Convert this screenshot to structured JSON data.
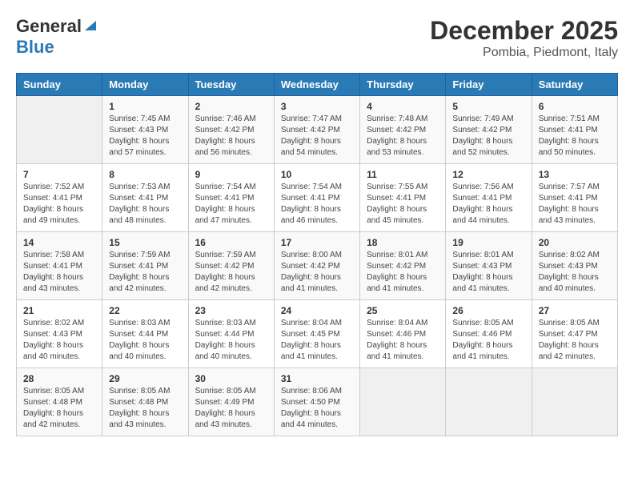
{
  "logo": {
    "general": "General",
    "blue": "Blue"
  },
  "title": "December 2025",
  "subtitle": "Pombia, Piedmont, Italy",
  "days_of_week": [
    "Sunday",
    "Monday",
    "Tuesday",
    "Wednesday",
    "Thursday",
    "Friday",
    "Saturday"
  ],
  "weeks": [
    [
      {
        "day": "",
        "info": ""
      },
      {
        "day": "1",
        "info": "Sunrise: 7:45 AM\nSunset: 4:43 PM\nDaylight: 8 hours\nand 57 minutes."
      },
      {
        "day": "2",
        "info": "Sunrise: 7:46 AM\nSunset: 4:42 PM\nDaylight: 8 hours\nand 56 minutes."
      },
      {
        "day": "3",
        "info": "Sunrise: 7:47 AM\nSunset: 4:42 PM\nDaylight: 8 hours\nand 54 minutes."
      },
      {
        "day": "4",
        "info": "Sunrise: 7:48 AM\nSunset: 4:42 PM\nDaylight: 8 hours\nand 53 minutes."
      },
      {
        "day": "5",
        "info": "Sunrise: 7:49 AM\nSunset: 4:42 PM\nDaylight: 8 hours\nand 52 minutes."
      },
      {
        "day": "6",
        "info": "Sunrise: 7:51 AM\nSunset: 4:41 PM\nDaylight: 8 hours\nand 50 minutes."
      }
    ],
    [
      {
        "day": "7",
        "info": "Sunrise: 7:52 AM\nSunset: 4:41 PM\nDaylight: 8 hours\nand 49 minutes."
      },
      {
        "day": "8",
        "info": "Sunrise: 7:53 AM\nSunset: 4:41 PM\nDaylight: 8 hours\nand 48 minutes."
      },
      {
        "day": "9",
        "info": "Sunrise: 7:54 AM\nSunset: 4:41 PM\nDaylight: 8 hours\nand 47 minutes."
      },
      {
        "day": "10",
        "info": "Sunrise: 7:54 AM\nSunset: 4:41 PM\nDaylight: 8 hours\nand 46 minutes."
      },
      {
        "day": "11",
        "info": "Sunrise: 7:55 AM\nSunset: 4:41 PM\nDaylight: 8 hours\nand 45 minutes."
      },
      {
        "day": "12",
        "info": "Sunrise: 7:56 AM\nSunset: 4:41 PM\nDaylight: 8 hours\nand 44 minutes."
      },
      {
        "day": "13",
        "info": "Sunrise: 7:57 AM\nSunset: 4:41 PM\nDaylight: 8 hours\nand 43 minutes."
      }
    ],
    [
      {
        "day": "14",
        "info": "Sunrise: 7:58 AM\nSunset: 4:41 PM\nDaylight: 8 hours\nand 43 minutes."
      },
      {
        "day": "15",
        "info": "Sunrise: 7:59 AM\nSunset: 4:41 PM\nDaylight: 8 hours\nand 42 minutes."
      },
      {
        "day": "16",
        "info": "Sunrise: 7:59 AM\nSunset: 4:42 PM\nDaylight: 8 hours\nand 42 minutes."
      },
      {
        "day": "17",
        "info": "Sunrise: 8:00 AM\nSunset: 4:42 PM\nDaylight: 8 hours\nand 41 minutes."
      },
      {
        "day": "18",
        "info": "Sunrise: 8:01 AM\nSunset: 4:42 PM\nDaylight: 8 hours\nand 41 minutes."
      },
      {
        "day": "19",
        "info": "Sunrise: 8:01 AM\nSunset: 4:43 PM\nDaylight: 8 hours\nand 41 minutes."
      },
      {
        "day": "20",
        "info": "Sunrise: 8:02 AM\nSunset: 4:43 PM\nDaylight: 8 hours\nand 40 minutes."
      }
    ],
    [
      {
        "day": "21",
        "info": "Sunrise: 8:02 AM\nSunset: 4:43 PM\nDaylight: 8 hours\nand 40 minutes."
      },
      {
        "day": "22",
        "info": "Sunrise: 8:03 AM\nSunset: 4:44 PM\nDaylight: 8 hours\nand 40 minutes."
      },
      {
        "day": "23",
        "info": "Sunrise: 8:03 AM\nSunset: 4:44 PM\nDaylight: 8 hours\nand 40 minutes."
      },
      {
        "day": "24",
        "info": "Sunrise: 8:04 AM\nSunset: 4:45 PM\nDaylight: 8 hours\nand 41 minutes."
      },
      {
        "day": "25",
        "info": "Sunrise: 8:04 AM\nSunset: 4:46 PM\nDaylight: 8 hours\nand 41 minutes."
      },
      {
        "day": "26",
        "info": "Sunrise: 8:05 AM\nSunset: 4:46 PM\nDaylight: 8 hours\nand 41 minutes."
      },
      {
        "day": "27",
        "info": "Sunrise: 8:05 AM\nSunset: 4:47 PM\nDaylight: 8 hours\nand 42 minutes."
      }
    ],
    [
      {
        "day": "28",
        "info": "Sunrise: 8:05 AM\nSunset: 4:48 PM\nDaylight: 8 hours\nand 42 minutes."
      },
      {
        "day": "29",
        "info": "Sunrise: 8:05 AM\nSunset: 4:48 PM\nDaylight: 8 hours\nand 43 minutes."
      },
      {
        "day": "30",
        "info": "Sunrise: 8:05 AM\nSunset: 4:49 PM\nDaylight: 8 hours\nand 43 minutes."
      },
      {
        "day": "31",
        "info": "Sunrise: 8:06 AM\nSunset: 4:50 PM\nDaylight: 8 hours\nand 44 minutes."
      },
      {
        "day": "",
        "info": ""
      },
      {
        "day": "",
        "info": ""
      },
      {
        "day": "",
        "info": ""
      }
    ]
  ]
}
